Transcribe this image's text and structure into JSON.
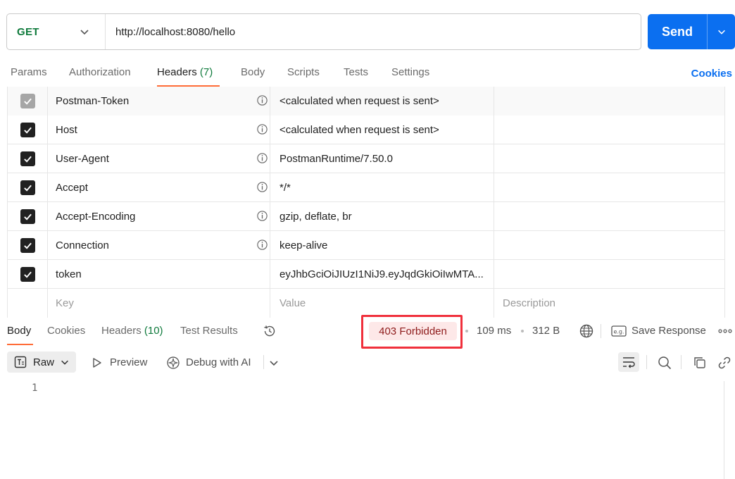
{
  "request": {
    "method": "GET",
    "url": "http://localhost:8080/hello",
    "send_label": "Send"
  },
  "request_tabs": {
    "params": "Params",
    "authorization": "Authorization",
    "headers": "Headers",
    "headers_count": "(7)",
    "body": "Body",
    "scripts": "Scripts",
    "tests": "Tests",
    "settings": "Settings",
    "cookies": "Cookies"
  },
  "headers": [
    {
      "key": "Postman-Token",
      "value": "<calculated when request is sent>",
      "checked": true,
      "locked": true
    },
    {
      "key": "Host",
      "value": "<calculated when request is sent>",
      "checked": true,
      "locked": false
    },
    {
      "key": "User-Agent",
      "value": "PostmanRuntime/7.50.0",
      "checked": true,
      "locked": false
    },
    {
      "key": "Accept",
      "value": "*/*",
      "checked": true,
      "locked": false
    },
    {
      "key": "Accept-Encoding",
      "value": "gzip, deflate, br",
      "checked": true,
      "locked": false
    },
    {
      "key": "Connection",
      "value": "keep-alive",
      "checked": true,
      "locked": false
    },
    {
      "key": "token",
      "value": "eyJhbGciOiJIUzI1NiJ9.eyJqdGkiOiIwMTA...",
      "checked": true,
      "locked": false
    }
  ],
  "headers_placeholders": {
    "key": "Key",
    "value": "Value",
    "description": "Description"
  },
  "response_tabs": {
    "body": "Body",
    "cookies": "Cookies",
    "headers": "Headers",
    "headers_count": "(10)",
    "test_results": "Test Results"
  },
  "response_status": {
    "status": "403 Forbidden",
    "time": "109 ms",
    "size": "312 B",
    "save_response": "Save Response"
  },
  "response_tools": {
    "format": "Raw",
    "preview": "Preview",
    "debug_ai": "Debug with AI"
  },
  "editor": {
    "line_numbers": [
      "1"
    ]
  },
  "colors": {
    "accent": "#ff6c37",
    "send": "#0b6ff0",
    "method_get": "#0f7a3c",
    "status_error_bg": "#fde8e8",
    "status_error_text": "#8e1b1b",
    "highlight_border": "#f0303c"
  }
}
